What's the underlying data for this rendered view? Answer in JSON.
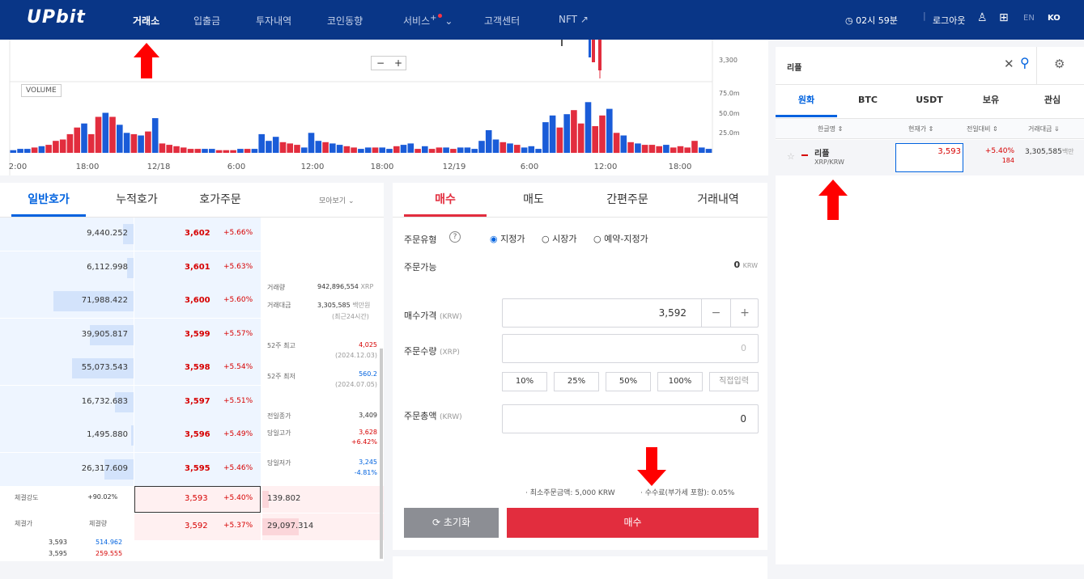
{
  "brand": {
    "logo": "UPbit"
  },
  "nav": {
    "items": [
      "거래소",
      "입출금",
      "투자내역",
      "코인동향",
      "서비스",
      "고객센터",
      "NFT ↗"
    ],
    "service_plus": "+"
  },
  "topright": {
    "time": "◷ 02시 59분",
    "logout": "로그아웃",
    "lang_en": "EN",
    "lang_ko": "KO"
  },
  "chart": {
    "zoom_minus": "−",
    "zoom_plus": "+",
    "volume_label": "VOLUME",
    "price_label": "3,300",
    "volume_ticks": [
      "75.0m",
      "50.0m",
      "25.0m"
    ],
    "x_ticks": [
      "2:00",
      "18:00",
      "12/18",
      "6:00",
      "12:00",
      "18:00",
      "12/19",
      "6:00",
      "12:00",
      "18:00"
    ],
    "volumes": [
      2,
      3,
      3,
      4,
      5,
      6,
      9,
      10,
      14,
      19,
      22,
      14,
      27,
      30,
      27,
      21,
      15,
      14,
      13,
      16,
      26,
      7,
      6,
      5,
      4,
      3,
      3,
      3,
      3,
      2,
      2,
      2,
      3,
      3,
      3,
      14,
      9,
      12,
      8,
      7,
      6,
      4,
      15,
      9,
      8,
      7,
      6,
      5,
      4,
      3,
      4,
      4,
      4,
      3,
      5,
      6,
      7,
      3,
      5,
      3,
      4,
      4,
      3,
      4,
      4,
      3,
      9,
      17,
      10,
      8,
      7,
      6,
      4,
      5,
      3,
      23,
      28,
      19,
      29,
      32,
      22,
      38,
      20,
      28,
      33,
      15,
      13,
      8,
      7,
      6,
      6,
      5,
      6,
      4,
      5,
      4,
      9,
      4,
      3
    ],
    "vol_colors": [
      "b",
      "b",
      "b",
      "r",
      "b",
      "r",
      "r",
      "r",
      "r",
      "r",
      "b",
      "r",
      "r",
      "b",
      "r",
      "b",
      "b",
      "r",
      "b",
      "r",
      "b",
      "r",
      "r",
      "r",
      "r",
      "r",
      "r",
      "b",
      "b",
      "r",
      "r",
      "r",
      "b",
      "r",
      "b",
      "b",
      "b",
      "b",
      "r",
      "r",
      "r",
      "b",
      "b",
      "b",
      "r",
      "b",
      "b",
      "r",
      "r",
      "b",
      "b",
      "r",
      "b",
      "b",
      "r",
      "b",
      "b",
      "r",
      "b",
      "r",
      "r",
      "b",
      "r",
      "b",
      "b",
      "b",
      "b",
      "b",
      "b",
      "r",
      "b",
      "r",
      "b",
      "b",
      "b",
      "b",
      "b",
      "r",
      "b",
      "r",
      "r",
      "b",
      "r",
      "r",
      "b",
      "r",
      "b",
      "r",
      "b",
      "r",
      "r",
      "r",
      "b",
      "r",
      "r",
      "r",
      "r",
      "b",
      "b"
    ]
  },
  "orderbook": {
    "tabs": [
      "일반호가",
      "누적호가",
      "호가주문"
    ],
    "view_more": "모아보기",
    "asks": [
      {
        "size": "9,440.252",
        "price": "3,602",
        "pct": "+5.66%",
        "bar": 0.08
      },
      {
        "size": "6,112.998",
        "price": "3,601",
        "pct": "+5.63%",
        "bar": 0.05
      },
      {
        "size": "71,988.422",
        "price": "3,600",
        "pct": "+5.60%",
        "bar": 0.6
      },
      {
        "size": "39,905.817",
        "price": "3,599",
        "pct": "+5.57%",
        "bar": 0.33
      },
      {
        "size": "55,073.543",
        "price": "3,598",
        "pct": "+5.54%",
        "bar": 0.46
      },
      {
        "size": "16,732.683",
        "price": "3,597",
        "pct": "+5.51%",
        "bar": 0.14
      },
      {
        "size": "1,495.880",
        "price": "3,596",
        "pct": "+5.49%",
        "bar": 0.02
      },
      {
        "size": "26,317.609",
        "price": "3,595",
        "pct": "+5.46%",
        "bar": 0.22
      }
    ],
    "bids": [
      {
        "price": "3,593",
        "pct": "+5.40%",
        "size": "139.802",
        "bar": 0.05
      },
      {
        "price": "3,592",
        "pct": "+5.37%",
        "size": "29,097.314",
        "bar": 0.3
      }
    ],
    "info": {
      "vol_label": "거래량",
      "vol": "942,896,554",
      "vol_unit": "XRP",
      "amt_label": "거래대금",
      "amt": "3,305,585",
      "amt_unit": "백만원",
      "amt_note": "(최근24시간)",
      "hi52_label": "52주 최고",
      "hi52": "4,025",
      "hi52_date": "(2024.12.03)",
      "lo52_label": "52주 최저",
      "lo52": "560.2",
      "lo52_date": "(2024.07.05)",
      "prev_label": "전일종가",
      "prev": "3,409",
      "high_label": "당일고가",
      "high": "3,628",
      "high_pct": "+6.42%",
      "low_label": "당일저가",
      "low": "3,245",
      "low_pct": "-4.81%"
    },
    "strength_label": "체결강도",
    "strength": "+90.02%",
    "fill_price_label": "체결가",
    "fill_qty_label": "체결량",
    "fills": [
      {
        "p": "3,593",
        "q": "514.962"
      },
      {
        "p": "3,595",
        "q": "259.555"
      }
    ]
  },
  "order": {
    "tabs": [
      "매수",
      "매도",
      "간편주문",
      "거래내역"
    ],
    "type_label": "주문유형",
    "help": "?",
    "types": [
      "지정가",
      "시장가",
      "예약-지정가"
    ],
    "avail_label": "주문가능",
    "avail_val": "0",
    "avail_unit": "KRW",
    "price_label": "매수가격",
    "price_unit": "(KRW)",
    "price": "3,592",
    "minus": "−",
    "plus": "+",
    "qty_label": "주문수량",
    "qty_unit": "(XRP)",
    "qty_ph": "0",
    "pcts": [
      "10%",
      "25%",
      "50%",
      "100%",
      "직접입력"
    ],
    "total_label": "주문총액",
    "total_unit": "(KRW)",
    "total": "0",
    "min_note": "· 최소주문금액: 5,000 KRW",
    "fee_note": "· 수수료(부가세 포함): 0.05%",
    "reset": "⟳ 초기화",
    "buy": "매수"
  },
  "market": {
    "search_value": "리플",
    "tabs": [
      "원화",
      "BTC",
      "USDT",
      "보유",
      "관심"
    ],
    "cols": [
      "한글명 ⇕",
      "현재가 ⇕",
      "전일대비 ⇕",
      "거래대금 ⇓"
    ],
    "coin": {
      "star": "☆",
      "name": "리플",
      "pair": "XRP/KRW",
      "price": "3,593",
      "change_pct": "+5.40%",
      "change": "184",
      "volume": "3,305,585",
      "volume_unit": "백만"
    }
  },
  "colors": {
    "nav": "#093687",
    "red": "#d60000",
    "blue": "#0062df",
    "buy": "#e22d3e",
    "ask_bg": "#eef5ff",
    "bid_bg": "#fff0f1",
    "arrow": "#ff0000"
  }
}
